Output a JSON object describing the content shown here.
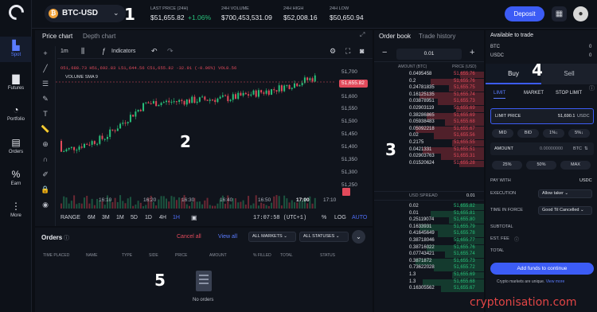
{
  "nav": {
    "items": [
      {
        "label": "Spot",
        "icon": "spot-chart-icon"
      },
      {
        "label": "Futures",
        "icon": "futures-bars-icon"
      },
      {
        "label": "Portfolio",
        "icon": "pie-icon"
      },
      {
        "label": "Orders",
        "icon": "document-icon"
      },
      {
        "label": "Earn",
        "icon": "percent-icon"
      },
      {
        "label": "More",
        "icon": "more-dots-icon"
      }
    ]
  },
  "header": {
    "pair": "BTC-USD",
    "pair_icon": "₿",
    "last_price_label": "LAST PRICE (24H)",
    "last_price": "$51,655.82",
    "change": "+1.06%",
    "volume_label": "24H VOLUME",
    "volume": "$700,453,531.09",
    "high_label": "24H HIGH",
    "high": "$52,008.16",
    "low_label": "24H LOW",
    "low": "$50,650.94",
    "deposit": "Deposit"
  },
  "callouts": [
    "1",
    "2",
    "3",
    "4",
    "5"
  ],
  "chart": {
    "tabs": [
      "Price chart",
      "Depth chart"
    ],
    "interval": "1m",
    "indicators": "Indicators",
    "ohlc": {
      "o": "O51,688.73",
      "h": "H51,692.83",
      "l": "L51,644.56",
      "c": "C51,655.82",
      "chg": "-32.91 (-0.06%)",
      "vol": "VOL8.56"
    },
    "volume_label": "VOLUME SMA 9",
    "price_ticks": [
      "51,700",
      "51,655.82",
      "51,600",
      "51,550",
      "51,500",
      "51,450",
      "51,400",
      "51,350",
      "51,300",
      "51,250"
    ],
    "time_ticks": [
      "16:10",
      "16:20",
      "16:30",
      "16:40",
      "16:50",
      "17:00",
      "17:10"
    ],
    "ranges": [
      "RANGE",
      "6M",
      "3M",
      "1M",
      "5D",
      "1D",
      "4H",
      "1H"
    ],
    "clock": "17:07:58 (UTC+1)",
    "scale_opts": [
      "%",
      "LOG",
      "AUTO"
    ]
  },
  "chart_data": {
    "type": "candlestick",
    "x": [
      "16:10",
      "16:20",
      "16:30",
      "16:40",
      "16:50",
      "17:00",
      "17:07"
    ],
    "close": [
      51380,
      51430,
      51560,
      51570,
      51580,
      51610,
      51656
    ],
    "ylim": [
      51230,
      51720
    ]
  },
  "orders": {
    "title": "Orders",
    "cancel_all": "Cancel all",
    "view_all": "View all",
    "market_filter": "ALL MARKETS",
    "status_filter": "ALL STATUSES",
    "columns": [
      "TIME PLACED",
      "NAME",
      "TYPE",
      "SIDE",
      "PRICE",
      "AMOUNT",
      "% FILLED",
      "TOTAL",
      "STATUS"
    ],
    "empty": "No orders"
  },
  "orderbook": {
    "tabs": [
      "Order book",
      "Trade history"
    ],
    "tick": "0.01",
    "amount_head": "AMOUNT (BTC)",
    "price_head": "PRICE (USD)",
    "asks": [
      [
        "0.0495458",
        "51,655.76"
      ],
      [
        "0.2",
        "51,655.76"
      ],
      [
        "0.24781835",
        "51,655.75"
      ],
      [
        "0.16125135",
        "51,655.74"
      ],
      [
        "0.03878951",
        "51,655.73"
      ],
      [
        "0.02903119",
        "51,655.69"
      ],
      [
        "0.38286865",
        "51,655.69"
      ],
      [
        "0.05938483",
        "51,655.68"
      ],
      [
        "0.05092218",
        "51,655.67"
      ],
      [
        "0.02",
        "51,655.56"
      ],
      [
        "0.2175",
        "51,655.55"
      ],
      [
        "0.0421331",
        "51,655.51"
      ],
      [
        "0.02903763",
        "51,655.31"
      ],
      [
        "0.01520624",
        "51,655.28"
      ]
    ],
    "spread_label": "USD SPREAD",
    "spread": "0.01",
    "bids": [
      [
        "0.02",
        "51,655.82"
      ],
      [
        "0.01",
        "51,655.81"
      ],
      [
        "0.25119074",
        "51,655.80"
      ],
      [
        "0.1633931",
        "51,655.79"
      ],
      [
        "0.41645649",
        "51,655.78"
      ],
      [
        "0.38718046",
        "51,655.77"
      ],
      [
        "0.38716022",
        "51,655.76"
      ],
      [
        "0.07743421",
        "51,655.74"
      ],
      [
        "0.3871872",
        "51,655.73"
      ],
      [
        "0.73622028",
        "51,655.72"
      ],
      [
        "1.3",
        "51,655.69"
      ],
      [
        "1.3",
        "51,655.68"
      ],
      [
        "0.16305562",
        "51,655.67"
      ]
    ]
  },
  "trade": {
    "title": "Available to trade",
    "balances": [
      {
        "coin": "BTC",
        "value": "0"
      },
      {
        "coin": "USDC",
        "value": "0"
      }
    ],
    "buy": "Buy",
    "sell": "Sell",
    "order_types": [
      "LIMIT",
      "MARKET",
      "STOP LIMIT"
    ],
    "limit_price_label": "LIMIT PRICE",
    "limit_price_value": "51,690.1",
    "limit_price_unit": "USDC",
    "price_pills": [
      "MID",
      "BID",
      "1%↓",
      "5%↓"
    ],
    "amount_label": "AMOUNT",
    "amount_value": "0.00000000",
    "amount_unit": "BTC",
    "amount_pills": [
      "25%",
      "50%",
      "MAX"
    ],
    "pay_with_label": "PAY WITH",
    "pay_with": "USDC",
    "execution_label": "EXECUTION",
    "execution": "Allow taker",
    "tif_label": "TIME IN FORCE",
    "tif": "Good Til Cancelled",
    "subtotal": "SUBTOTAL",
    "fee": "EST. FEE",
    "total": "TOTAL",
    "cta": "Add funds to continue",
    "unique_note": "Crypto markets are unique.",
    "view_more": "View more"
  },
  "watermark": "cryptonisation.com"
}
